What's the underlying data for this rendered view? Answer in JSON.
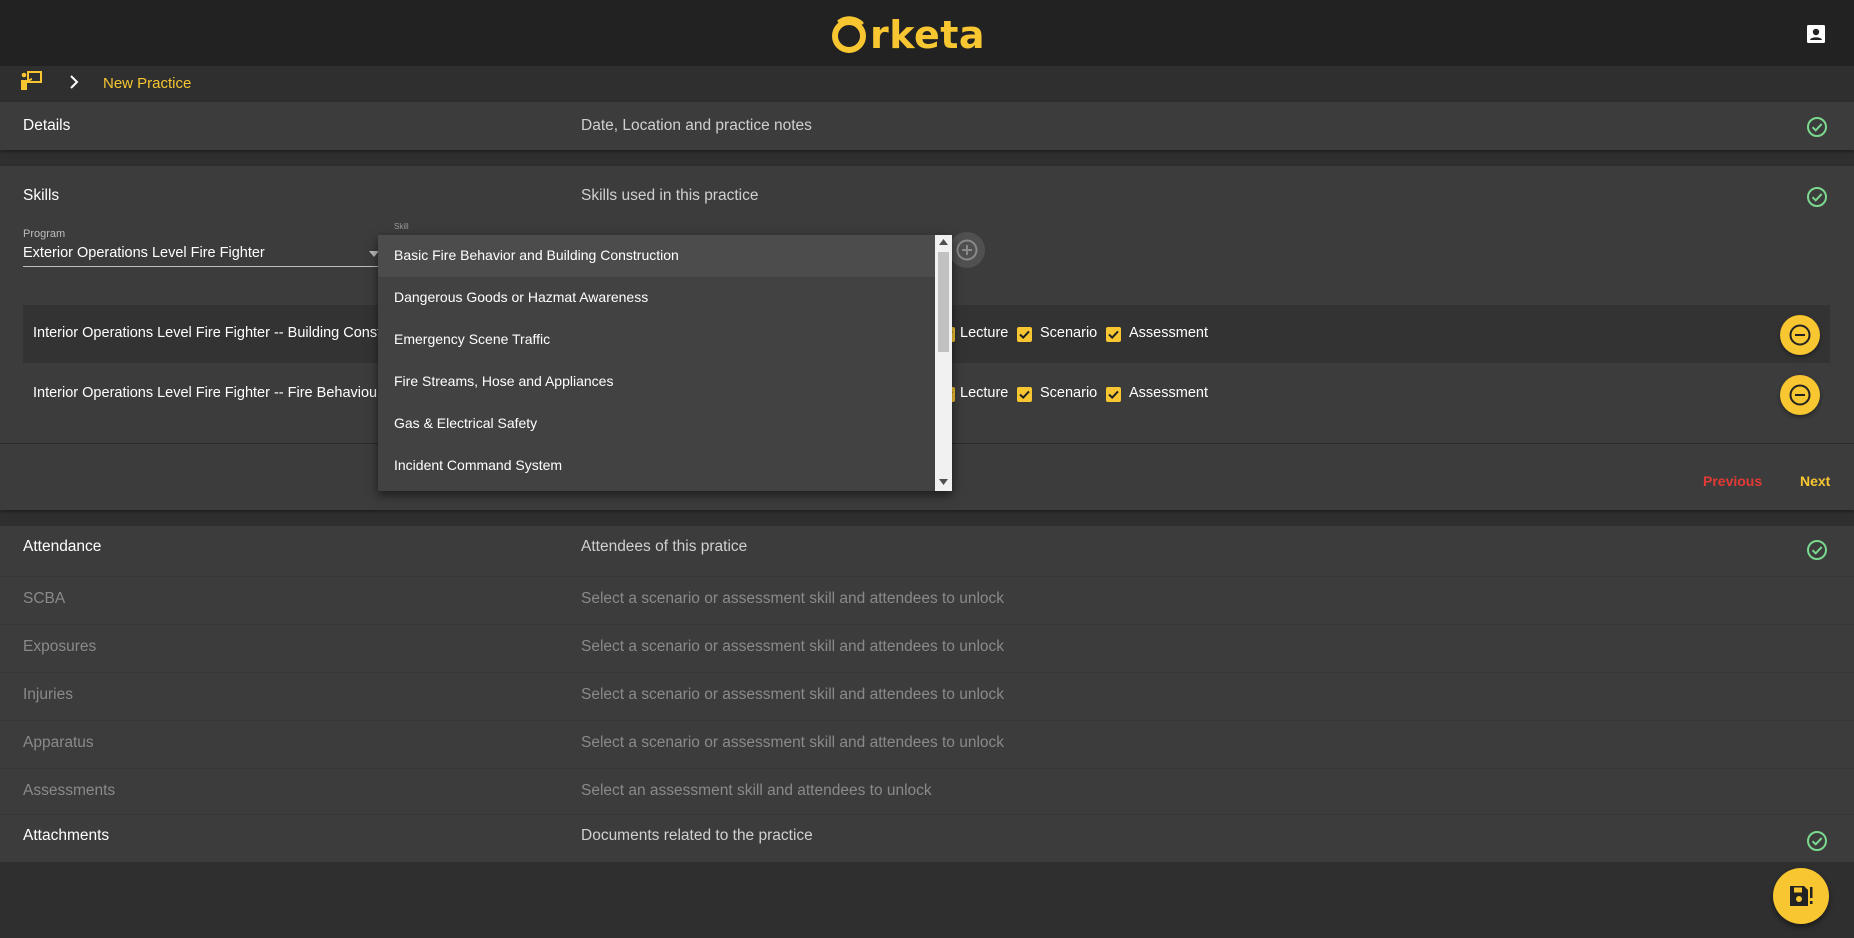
{
  "header": {
    "logo_text": "rketa",
    "logo_icon": "orketa-ring-logo",
    "account_icon": "account-box-icon"
  },
  "breadcrumb": {
    "home_icon": "instructor-board-icon",
    "separator_icon": "chevron-right-icon",
    "current": "New Practice"
  },
  "sections": {
    "details": {
      "title": "Details",
      "subtitle": "Date, Location and practice notes",
      "complete": true
    },
    "skills": {
      "title": "Skills",
      "subtitle": "Skills used in this practice",
      "complete": true,
      "program_label": "Program",
      "program_value": "Exterior Operations Level Fire Fighter",
      "skill_label": "Skill",
      "rows": [
        {
          "name": "Interior Operations Level Fire Fighter -- Building Construction",
          "lecture": "Lecture",
          "lecture_checked": true,
          "scenario": "Scenario",
          "scenario_checked": true,
          "assessment": "Assessment",
          "assessment_checked": true
        },
        {
          "name": "Interior Operations Level Fire Fighter -- Fire Behaviour",
          "lecture": "Lecture",
          "lecture_checked": true,
          "scenario": "Scenario",
          "scenario_checked": true,
          "assessment": "Assessment",
          "assessment_checked": true
        }
      ],
      "previous_label": "Previous",
      "next_label": "Next"
    },
    "attendance": {
      "title": "Attendance",
      "subtitle": "Attendees of this pratice",
      "complete": true
    },
    "scba": {
      "title": "SCBA",
      "subtitle": "Select a scenario or assessment skill and attendees to unlock"
    },
    "exposures": {
      "title": "Exposures",
      "subtitle": "Select a scenario or assessment skill and attendees to unlock"
    },
    "injuries": {
      "title": "Injuries",
      "subtitle": "Select a scenario or assessment skill and attendees to unlock"
    },
    "apparatus": {
      "title": "Apparatus",
      "subtitle": "Select a scenario or assessment skill and attendees to unlock"
    },
    "assessments": {
      "title": "Assessments",
      "subtitle": "Select an assessment skill and attendees to unlock"
    },
    "attachments": {
      "title": "Attachments",
      "subtitle": "Documents related to the practice",
      "complete": true
    }
  },
  "skill_dropdown": {
    "options": [
      "Basic Fire Behavior and Building Construction",
      "Dangerous Goods or Hazmat Awareness",
      "Emergency Scene Traffic",
      "Fire Streams, Hose and Appliances",
      "Gas & Electrical Safety",
      "Incident Command System"
    ]
  },
  "colors": {
    "accent": "#f7c631",
    "success": "#7bd88f",
    "danger": "#e53935",
    "background": "#2f2f2f",
    "panel": "#3c3c3c",
    "topbar": "#222222"
  },
  "fab": {
    "icon": "save-alert-icon"
  }
}
